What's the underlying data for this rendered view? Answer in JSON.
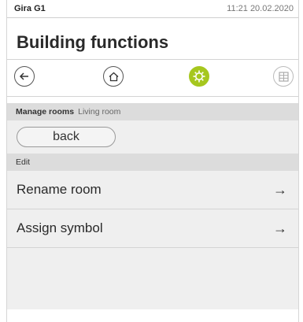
{
  "status": {
    "device_name": "Gira G1",
    "time_date": "11:21 20.02.2020"
  },
  "page": {
    "title": "Building functions"
  },
  "nav": {
    "back_icon": "arrow-left-circle-icon",
    "home_icon": "home-icon",
    "settings_icon": "gear-icon",
    "grid_icon": "grid-icon",
    "active_color": "#a6c71e"
  },
  "manage": {
    "label": "Manage rooms",
    "room": "Living room",
    "back_label": "back"
  },
  "edit": {
    "header": "Edit",
    "items": [
      {
        "label": "Rename room",
        "arrow": "→"
      },
      {
        "label": "Assign symbol",
        "arrow": "→"
      }
    ]
  }
}
